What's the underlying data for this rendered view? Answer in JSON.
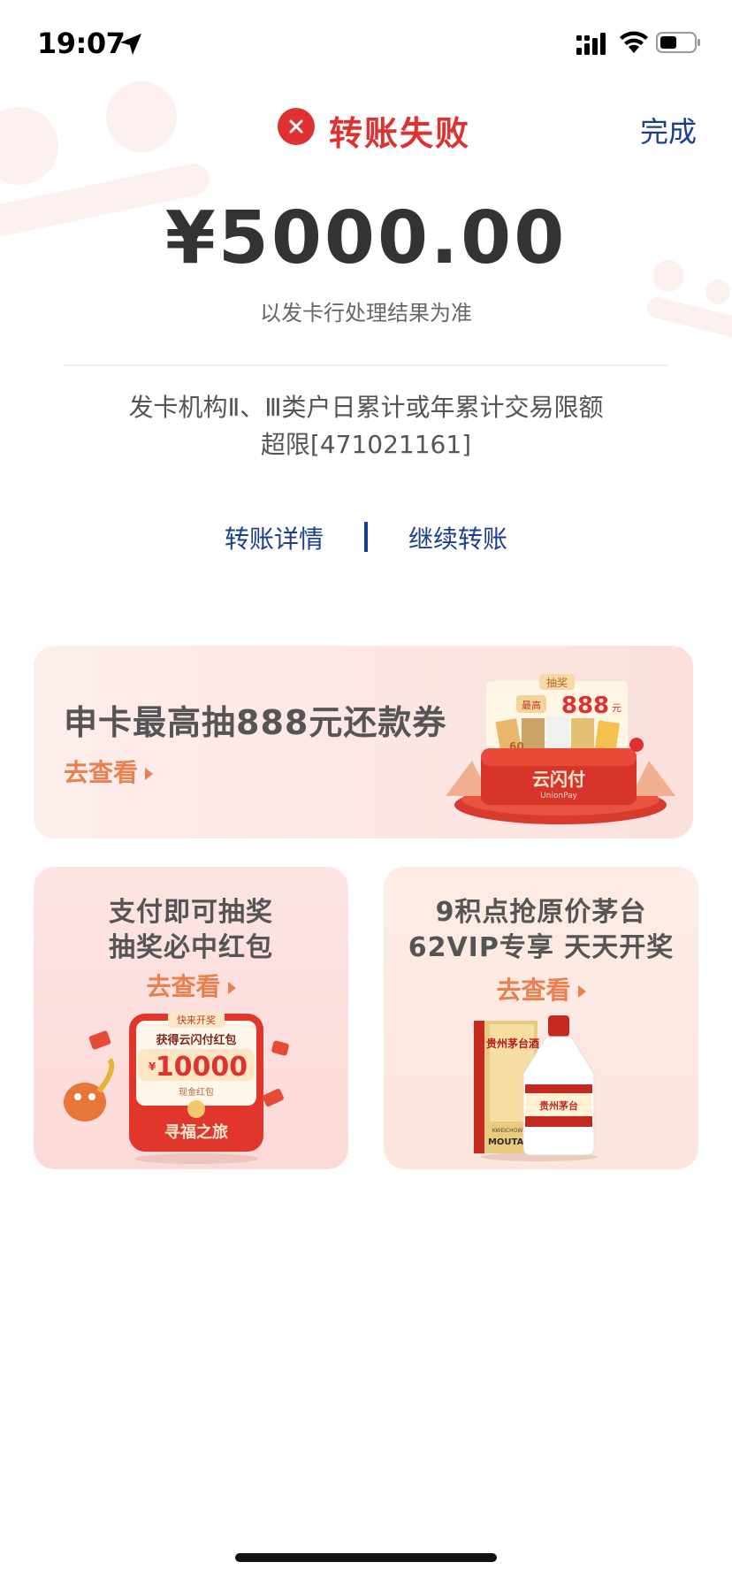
{
  "status_bar": {
    "time": "19:07"
  },
  "header": {
    "title": "转账失败",
    "done_label": "完成"
  },
  "transfer": {
    "amount": "¥5000.00",
    "note": "以发卡行处理结果为准",
    "error_line1": "发卡机构Ⅱ、Ⅲ类户日累计或年累计交易限额",
    "error_line2": "超限[471021161]"
  },
  "links": {
    "details": "转账详情",
    "continue": "继续转账"
  },
  "promo": {
    "title": "申卡最高抽888元还款券",
    "link": "去查看",
    "illus": {
      "tag": "抽奖",
      "badge": "最高",
      "amount": "888",
      "unit": "元",
      "brand": "云闪付",
      "brand_en": "UnionPay",
      "chip": "60"
    }
  },
  "cards": [
    {
      "line1": "支付即可抽奖",
      "line2": "抽奖必中红包",
      "link": "去查看",
      "illus": {
        "tag": "快来开奖",
        "caption": "获得云闪付红包",
        "currency": "¥",
        "amount": "10000",
        "sub": "现金红包",
        "brand": "寻福之旅"
      }
    },
    {
      "line1": "9积点抢原价茅台",
      "line2": "62VIP专享 天天开奖",
      "link": "去查看",
      "illus": {
        "box_title": "贵州茅台酒",
        "box_brand": "MOUTAI",
        "box_sub": "KWEICHOW",
        "bottle_label": "贵州茅台"
      }
    }
  ],
  "colors": {
    "error": "#e03131",
    "link": "#1c3e8e",
    "accent": "#e98050"
  }
}
